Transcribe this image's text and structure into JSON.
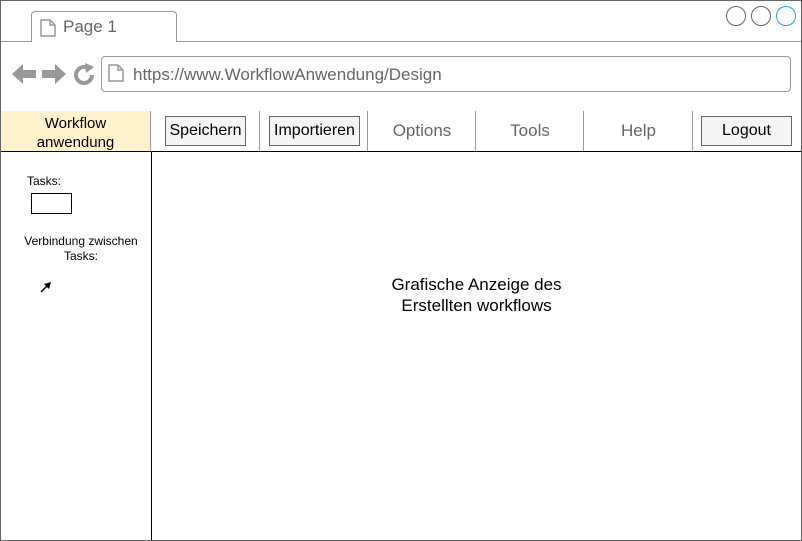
{
  "browser": {
    "tab_title": "Page 1",
    "url": "https://www.WorkflowAnwendung/Design",
    "accent_color": "#1aa3dd"
  },
  "menu": {
    "logo_line1": "Workflow",
    "logo_line2": "anwendung",
    "save_label": "Speichern",
    "import_label": "Importieren",
    "options_label": "Options",
    "tools_label": "Tools",
    "help_label": "Help",
    "logout_label": "Logout",
    "logo_bg": "#fff2cc"
  },
  "sidebar": {
    "tasks_label": "Tasks:",
    "connection_label_line1": "Verbindung zwischen",
    "connection_label_line2": "Tasks:"
  },
  "canvas": {
    "text_line1": "Grafische Anzeige des",
    "text_line2": "Erstellten workflows"
  }
}
